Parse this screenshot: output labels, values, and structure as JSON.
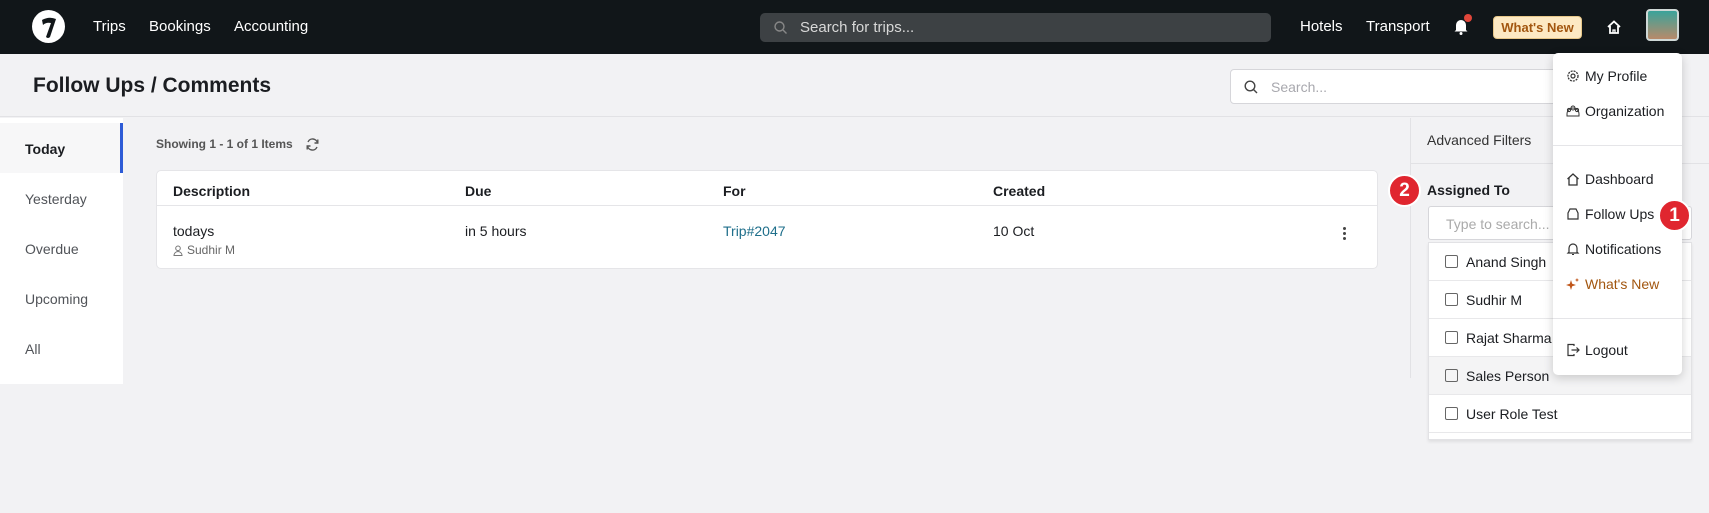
{
  "nav": {
    "links": [
      "Trips",
      "Bookings",
      "Accounting"
    ],
    "search_placeholder": "Search for trips...",
    "right_links": [
      "Hotels",
      "Transport"
    ],
    "whats_new": "What's New",
    "notification_dot": "#e0463a"
  },
  "page": {
    "title": "Follow Ups / Comments",
    "search_placeholder": "Search..."
  },
  "tabs": [
    {
      "label": "Today",
      "active": true
    },
    {
      "label": "Yesterday"
    },
    {
      "label": "Overdue"
    },
    {
      "label": "Upcoming"
    },
    {
      "label": "All"
    }
  ],
  "list": {
    "showing": "Showing 1 - 1 of 1 Items",
    "columns": [
      "Description",
      "Due",
      "For",
      "Created"
    ],
    "rows": [
      {
        "description": "todays",
        "assignee": "Sudhir M",
        "due": "in 5 hours",
        "for": "Trip#2047",
        "created": "10 Oct"
      }
    ]
  },
  "filters": {
    "title": "Advanced Filters",
    "assigned_label": "Assigned To",
    "search_placeholder": "Type to search...",
    "users": [
      "Anand Singh",
      "Sudhir M",
      "Rajat Sharma",
      "Sales Person",
      "User Role Test"
    ]
  },
  "profile_menu": {
    "items": [
      "My Profile",
      "Organization",
      "Dashboard",
      "Follow Ups",
      "Notifications",
      "What's New",
      "Logout"
    ]
  },
  "annotations": {
    "badge1": "1",
    "badge2": "2"
  },
  "colors": {
    "accent": "#2d5bd6",
    "link": "#1f6f8b",
    "whats_new": "#a2560f",
    "badge": "#e0262f"
  }
}
